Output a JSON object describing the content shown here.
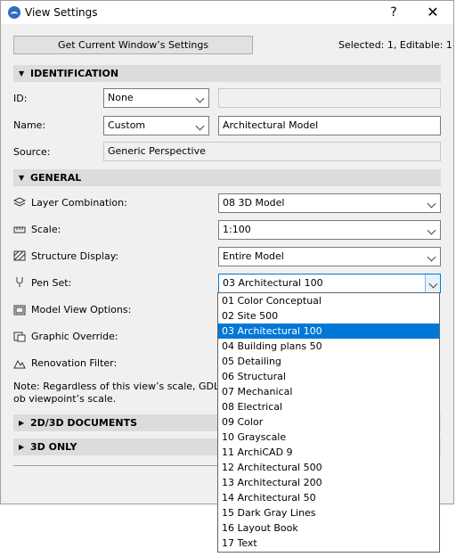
{
  "window": {
    "title": "View Settings",
    "help": "?",
    "close": "✕"
  },
  "top": {
    "get_settings_button": "Get Current Window’s Settings",
    "selection_info": "Selected: 1, Editable: 1"
  },
  "identification": {
    "header": "IDENTIFICATION",
    "id_label": "ID:",
    "id_value": "None",
    "id_custom": "",
    "name_label": "Name:",
    "name_value": "Custom",
    "name_text": "Architectural Model",
    "source_label": "Source:",
    "source_value": "Generic Perspective"
  },
  "general": {
    "header": "GENERAL",
    "layer_label": "Layer Combination:",
    "layer_value": "08 3D Model",
    "scale_label": "Scale:",
    "scale_value": "1:100",
    "structure_label": "Structure Display:",
    "structure_value": "Entire Model",
    "penset_label": "Pen Set:",
    "penset_value": "03 Architectural 100",
    "model_view_label": "Model View Options:",
    "graphic_override_label": "Graphic Override:",
    "renovation_label": "Renovation Filter:",
    "note": "Note: Regardless of this view’s scale, GDL ob viewpoint’s scale."
  },
  "sections": {
    "docs": "2D/3D DOCUMENTS",
    "only3d": "3D ONLY"
  },
  "penset_options": [
    "01 Color Conceptual",
    "02 Site 500",
    "03 Architectural 100",
    "04 Building plans 50",
    "05 Detailing",
    "06 Structural",
    "07 Mechanical",
    "08 Electrical",
    "09 Color",
    "10 Grayscale",
    "11 ArchiCAD 9",
    "12 Architectural 500",
    "13 Architectural 200",
    "14 Architectural 50",
    "15 Dark Gray Lines",
    "16 Layout Book",
    "17 Text"
  ],
  "penset_selected_index": 2,
  "icons": {
    "layer": "layers-icon",
    "scale": "ruler-icon",
    "structure": "hatch-icon",
    "penset": "pen-icon",
    "model_view": "model-view-icon",
    "graphic_override": "override-icon",
    "renovation": "filter-icon"
  }
}
